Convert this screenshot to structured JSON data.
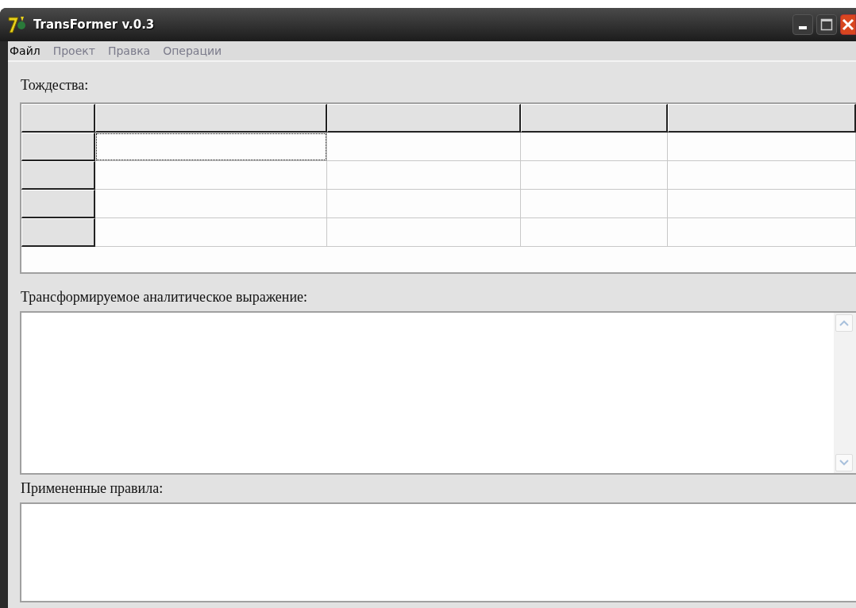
{
  "window": {
    "title": "TransFormer v.0.3"
  },
  "menu": [
    {
      "label": "Файл",
      "disabled": false
    },
    {
      "label": "Проект",
      "disabled": true
    },
    {
      "label": "Правка",
      "disabled": true
    },
    {
      "label": "Операции",
      "disabled": true
    }
  ],
  "identities": {
    "label": "Тождества:",
    "rows": [
      {
        "cells": [
          {
            "focused": true
          },
          {
            "focused": false
          },
          {
            "focused": false
          },
          {
            "focused": false
          }
        ]
      },
      {
        "cells": [
          {
            "focused": false
          },
          {
            "focused": false
          },
          {
            "focused": false
          },
          {
            "focused": false
          }
        ]
      },
      {
        "cells": [
          {
            "focused": false
          },
          {
            "focused": false
          },
          {
            "focused": false
          },
          {
            "focused": false
          }
        ]
      },
      {
        "cells": [
          {
            "focused": false
          },
          {
            "focused": false
          },
          {
            "focused": false
          },
          {
            "focused": false
          }
        ]
      }
    ]
  },
  "expression": {
    "label": "Трансформируемое аналитическое выражение:"
  },
  "applied_rules": {
    "label": "Примененные правила:"
  }
}
